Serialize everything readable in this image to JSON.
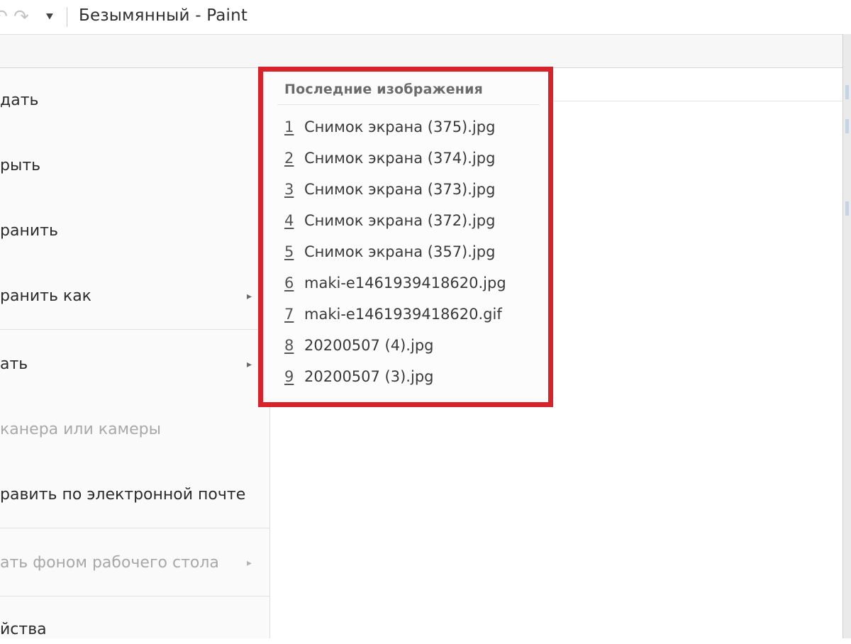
{
  "window": {
    "title": "Безымянный - Paint"
  },
  "file_menu": {
    "items": [
      {
        "label": "дать",
        "enabled": true,
        "has_submenu": false
      },
      {
        "label": "рыть",
        "enabled": true,
        "has_submenu": false
      },
      {
        "label": "ранить",
        "enabled": true,
        "has_submenu": false
      },
      {
        "label": "ранить как",
        "enabled": true,
        "has_submenu": true
      },
      {
        "label": "ать",
        "enabled": true,
        "has_submenu": true
      },
      {
        "label": "канера или камеры",
        "enabled": false,
        "has_submenu": false
      },
      {
        "label": "равить по электронной почте",
        "enabled": true,
        "has_submenu": false
      },
      {
        "label": "ать фоном рабочего стола",
        "enabled": false,
        "has_submenu": true
      },
      {
        "label": "йства",
        "enabled": true,
        "has_submenu": false
      }
    ],
    "arrow_glyph": "▸"
  },
  "recent_images": {
    "title": "Последние изображения",
    "items": [
      {
        "num": "1",
        "name": "Снимок экрана (375).jpg"
      },
      {
        "num": "2",
        "name": "Снимок экрана (374).jpg"
      },
      {
        "num": "3",
        "name": "Снимок экрана (373).jpg"
      },
      {
        "num": "4",
        "name": "Снимок экрана (372).jpg"
      },
      {
        "num": "5",
        "name": "Снимок экрана (357).jpg"
      },
      {
        "num": "6",
        "name": "maki-e1461939418620.jpg"
      },
      {
        "num": "7",
        "name": "maki-e1461939418620.gif"
      },
      {
        "num": "8",
        "name": "20200507 (4).jpg"
      },
      {
        "num": "9",
        "name": "20200507 (3).jpg"
      }
    ]
  },
  "colors": {
    "highlight_border": "#d8232a",
    "menu_background": "#fafafa",
    "disabled_text": "#a8a8a8"
  }
}
